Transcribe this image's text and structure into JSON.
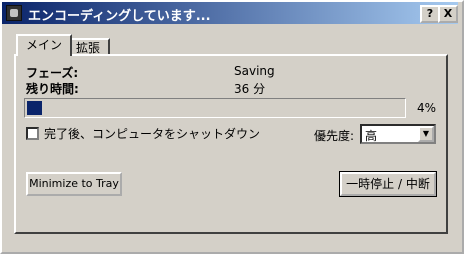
{
  "window": {
    "title": "エンコーディングしています...",
    "help_label": "?",
    "close_label": "X"
  },
  "tabs": [
    {
      "label": "メイン",
      "active": true
    },
    {
      "label": "拡張",
      "active": false
    }
  ],
  "status": {
    "phase_label": "フェーズ:",
    "phase_value": "Saving",
    "remaining_label": "残り時間:",
    "remaining_value": "36 分"
  },
  "progress": {
    "value_percent": 4,
    "label": "4%"
  },
  "shutdown": {
    "label": "完了後、コンピュータをシャットダウン",
    "checked": false
  },
  "priority": {
    "label": "優先度:",
    "selected": "高"
  },
  "buttons": {
    "minimize_to_tray": "Minimize to Tray",
    "pause_abort": "一時停止 / 中断"
  },
  "colors": {
    "titlebar_start": "#0a246a",
    "titlebar_end": "#a6caf0",
    "progress_fill": "#0a246a",
    "face": "#d4d0c8"
  }
}
